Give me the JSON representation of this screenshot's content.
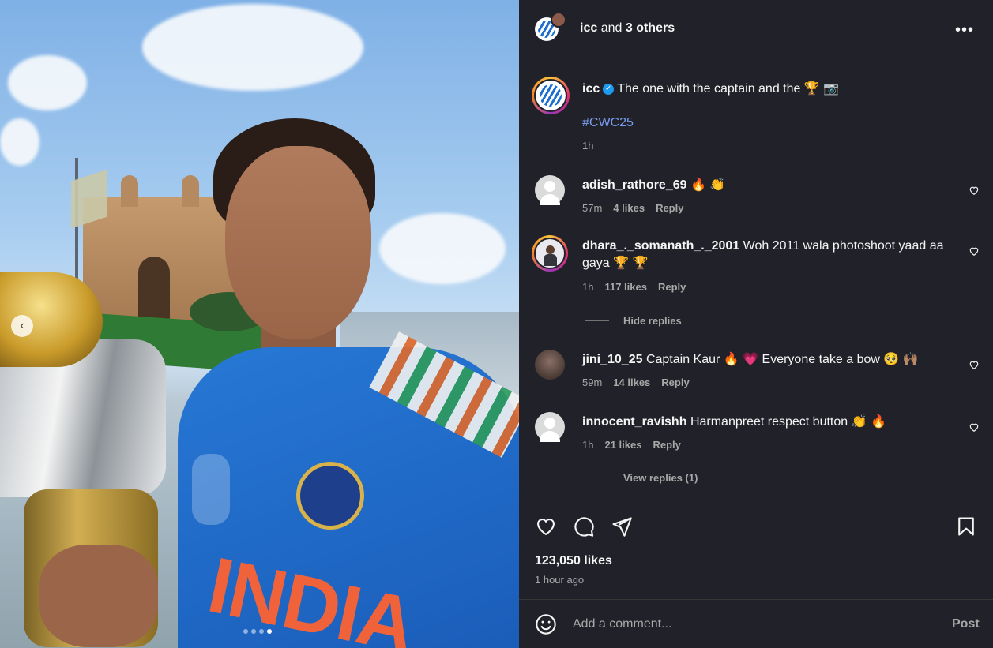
{
  "header": {
    "username": "icc",
    "connector": "and",
    "others": "3 others",
    "more_label": "•••"
  },
  "caption": {
    "username": "icc",
    "verified_mark": "✓",
    "text": "The one with the captain and the 🏆 📷",
    "hashtag": "#CWC25",
    "time": "1h"
  },
  "comments": [
    {
      "username": "adish_rathore_69",
      "text": "🔥 👏",
      "time": "57m",
      "likes": "4 likes",
      "reply": "Reply"
    },
    {
      "username": "dhara_._somanath_._2001",
      "text": "Woh 2011 wala photoshoot yaad aa gaya 🏆 🏆",
      "time": "1h",
      "likes": "117 likes",
      "reply": "Reply",
      "replies_toggle": "Hide replies"
    },
    {
      "username": "jini_10_25",
      "text": "Captain Kaur 🔥 💗 Everyone take a bow 🥺 🙌🏽",
      "time": "59m",
      "likes": "14 likes",
      "reply": "Reply"
    },
    {
      "username": "innocent_ravishh",
      "text": "Harmanpreet respect button 👏 🔥",
      "time": "1h",
      "likes": "21 likes",
      "reply": "Reply",
      "replies_toggle": "View replies (1)"
    }
  ],
  "post": {
    "likes": "123,050 likes",
    "time_ago": "1 hour ago"
  },
  "composer": {
    "placeholder": "Add a comment...",
    "post_label": "Post"
  },
  "carousel": {
    "prev_label": "‹",
    "current_slide": 4,
    "total_slides": 4
  },
  "icons": {
    "like": "heart-icon",
    "comment": "comment-icon",
    "share": "send-icon",
    "save": "bookmark-icon",
    "emoji": "smile-icon",
    "more": "more-icon",
    "comment_like": "heart-icon"
  },
  "colors": {
    "panel_bg": "#212229",
    "hashtag": "#7a9cf0",
    "muted": "#a8a8a8",
    "verified": "#1d9bf0"
  }
}
